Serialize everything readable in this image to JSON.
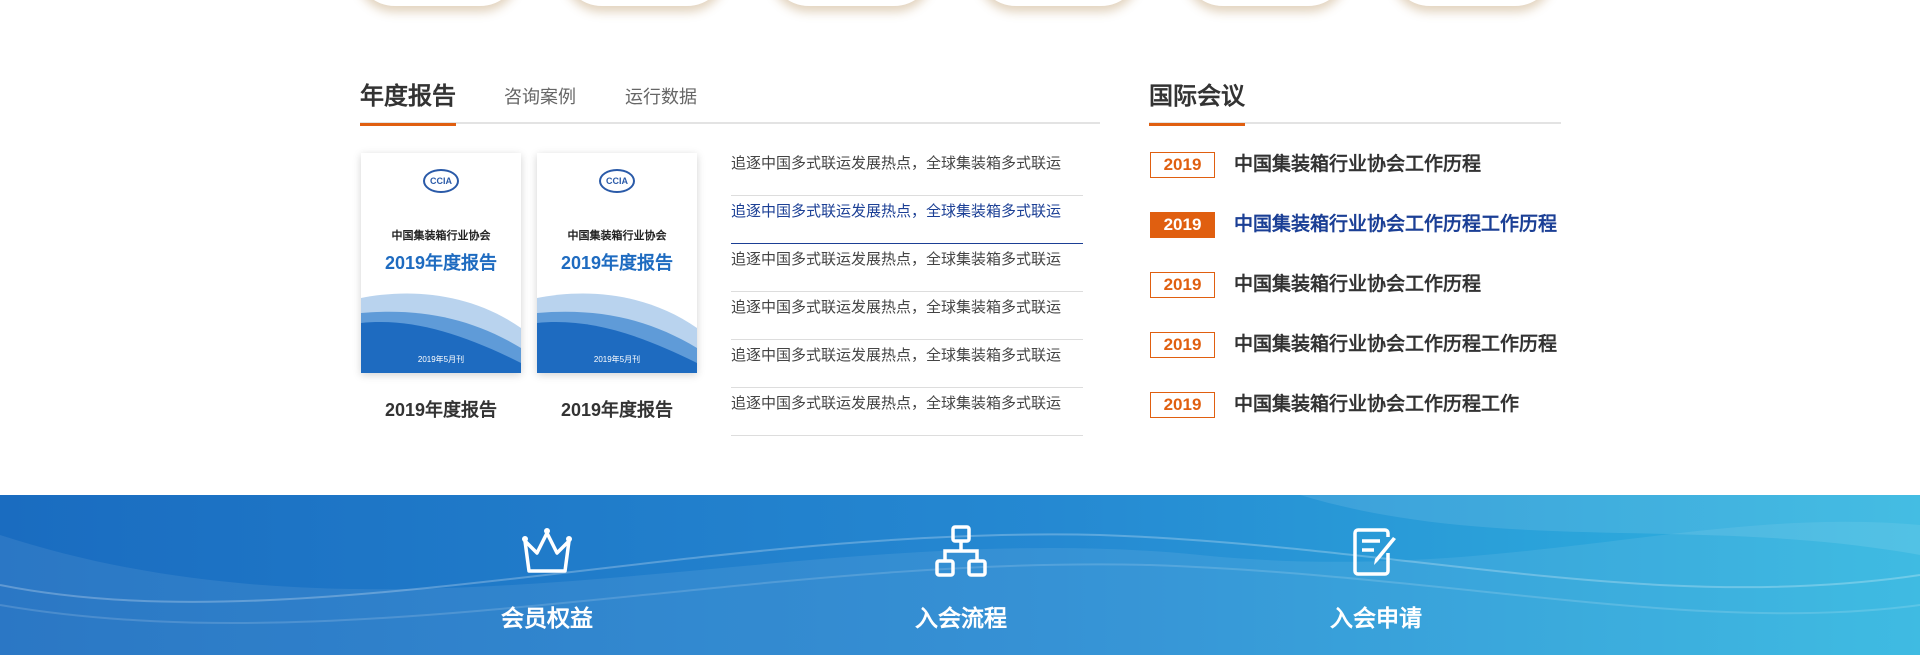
{
  "annual_tabs": [
    {
      "label": "年度报告",
      "active": true
    },
    {
      "label": "咨询案例",
      "active": false
    },
    {
      "label": "运行数据",
      "active": false
    }
  ],
  "reports": [
    {
      "logo": "CCIA",
      "org": "中国集装箱行业协会",
      "cover_title": "2019年度报告",
      "date": "2019年5月刊",
      "caption": "2019年度报告"
    },
    {
      "logo": "CCIA",
      "org": "中国集装箱行业协会",
      "cover_title": "2019年度报告",
      "date": "2019年5月刊",
      "caption": "2019年度报告"
    }
  ],
  "news": [
    {
      "text": "追逐中国多式联运发展热点，全球集装箱多式联运",
      "active": false
    },
    {
      "text": "追逐中国多式联运发展热点，全球集装箱多式联运",
      "active": true
    },
    {
      "text": "追逐中国多式联运发展热点，全球集装箱多式联运",
      "active": false
    },
    {
      "text": "追逐中国多式联运发展热点，全球集装箱多式联运",
      "active": false
    },
    {
      "text": "追逐中国多式联运发展热点，全球集装箱多式联运",
      "active": false
    },
    {
      "text": "追逐中国多式联运发展热点，全球集装箱多式联运",
      "active": false
    }
  ],
  "conference": {
    "title": "国际会议",
    "items": [
      {
        "year": "2019",
        "text": "中国集装箱行业协会工作历程",
        "active": false
      },
      {
        "year": "2019",
        "text": "中国集装箱行业协会工作历程工作历程",
        "active": true
      },
      {
        "year": "2019",
        "text": "中国集装箱行业协会工作历程",
        "active": false
      },
      {
        "year": "2019",
        "text": "中国集装箱行业协会工作历程工作历程",
        "active": false
      },
      {
        "year": "2019",
        "text": "中国集装箱行业协会工作历程工作",
        "active": false
      }
    ]
  },
  "banner": {
    "features": [
      {
        "label": "会员权益",
        "icon": "crown-icon"
      },
      {
        "label": "入会流程",
        "icon": "flowchart-icon"
      },
      {
        "label": "入会申请",
        "icon": "application-form-icon"
      }
    ]
  },
  "colors": {
    "accent": "#e05f10",
    "link_active": "#1b3f95",
    "report_blue": "#1e6bc0",
    "banner_dark": "#1a6cc0",
    "banner_light": "#2fb6e0"
  }
}
